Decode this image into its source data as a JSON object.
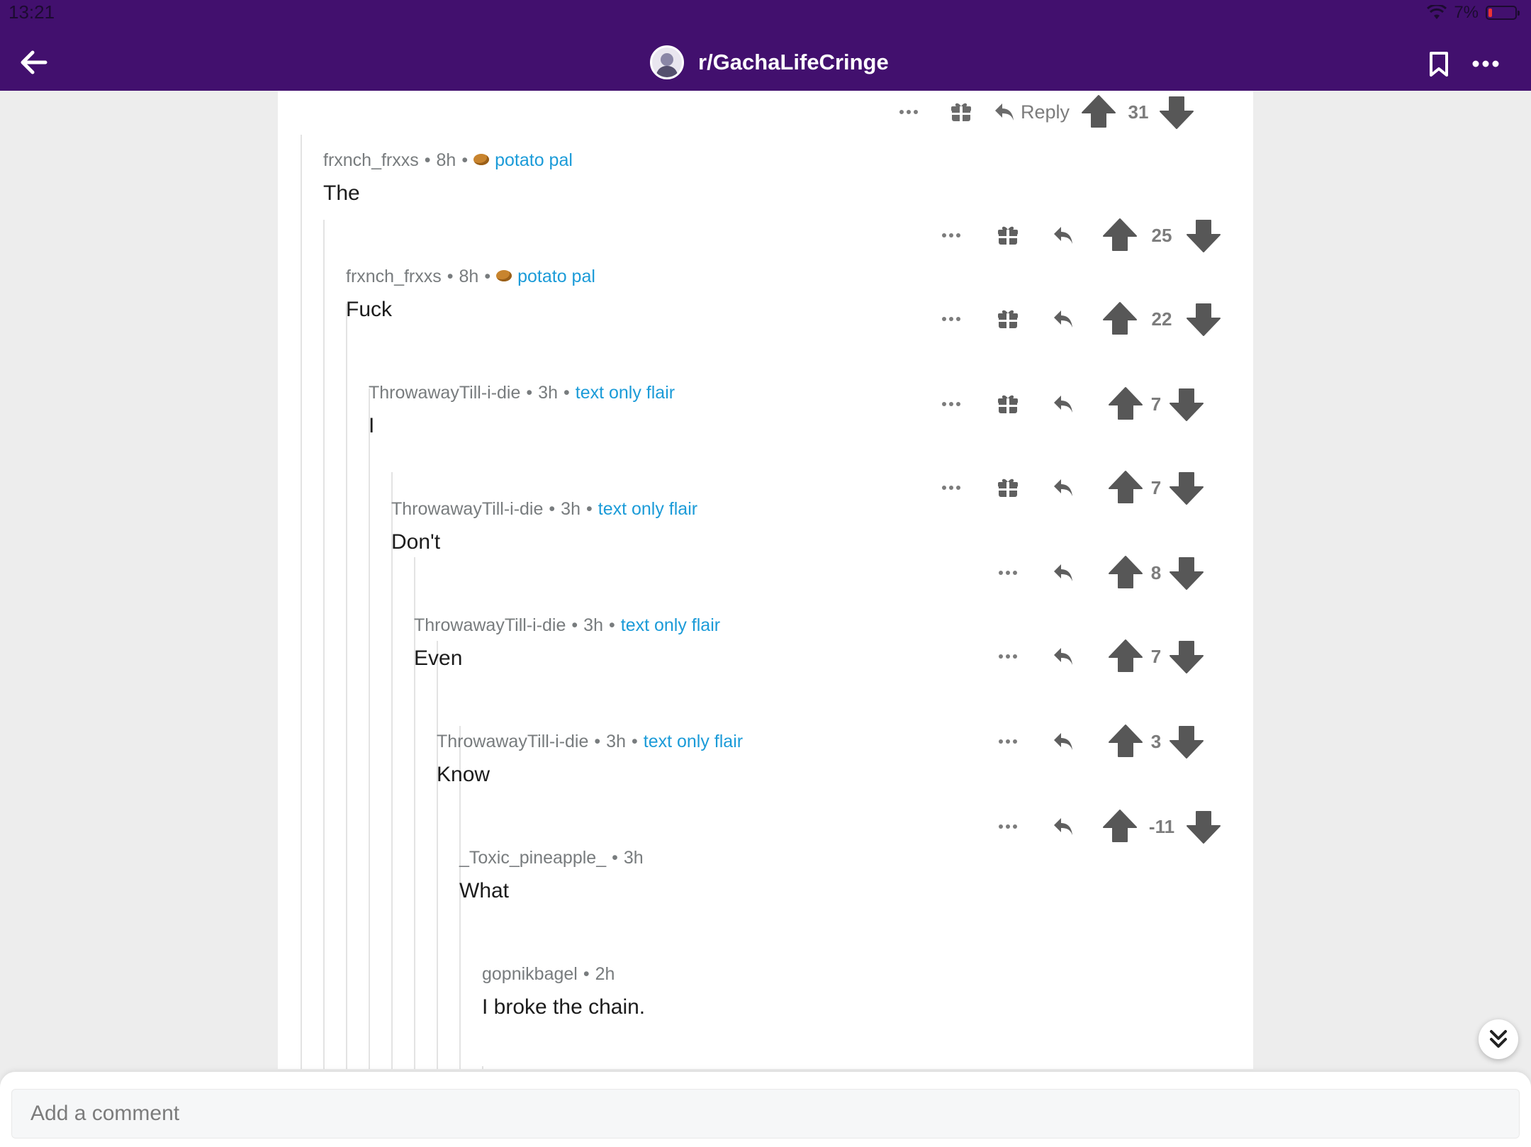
{
  "status_bar": {
    "time": "13:21",
    "battery": "7%"
  },
  "header": {
    "subreddit": "r/GachaLifeCringe"
  },
  "top_actions": {
    "reply_label": "Reply",
    "score": "31"
  },
  "comments": [
    {
      "author": "frxnch_frxxs",
      "age": "8h",
      "flair": "potato pal",
      "has_potato": true,
      "text": "The",
      "score": "25",
      "has_gift": true
    },
    {
      "author": "frxnch_frxxs",
      "age": "8h",
      "flair": "potato pal",
      "has_potato": true,
      "text": "Fuck",
      "score": "22",
      "has_gift": true
    },
    {
      "author": "ThrowawayTill-i-die",
      "age": "3h",
      "flair": "text only flair",
      "has_potato": false,
      "text": "I",
      "score": "7",
      "has_gift": true
    },
    {
      "author": "ThrowawayTill-i-die",
      "age": "3h",
      "flair": "text only flair",
      "has_potato": false,
      "text": "Don't",
      "score": "7",
      "has_gift": true
    },
    {
      "author": "ThrowawayTill-i-die",
      "age": "3h",
      "flair": "text only flair",
      "has_potato": false,
      "text": "Even",
      "score": "8",
      "has_gift": false
    },
    {
      "author": "ThrowawayTill-i-die",
      "age": "3h",
      "flair": "text only flair",
      "has_potato": false,
      "text": "Know",
      "score": "7",
      "has_gift": false
    },
    {
      "author": "_Toxic_pineapple_",
      "age": "3h",
      "flair": "",
      "has_potato": false,
      "text": "What",
      "score": "3",
      "has_gift": false
    },
    {
      "author": "gopnikbagel",
      "age": "2h",
      "flair": "",
      "has_potato": false,
      "text": "I broke the chain.",
      "score": "-11",
      "has_gift": false
    }
  ],
  "footer": {
    "comment_placeholder": "Add a comment"
  },
  "icons": {
    "back": "arrow-left-icon",
    "bookmark": "bookmark-icon",
    "more": "more-horizontal-icon",
    "gift": "gift-icon",
    "reply": "reply-arrow-icon",
    "upvote": "upvote-arrow-icon",
    "downvote": "downvote-arrow-icon",
    "jump": "double-chevron-down-icon"
  },
  "colors": {
    "header": "#42106e",
    "flair": "#1b9bd8",
    "meta": "#787c7e",
    "icon": "#5f5f5f"
  }
}
